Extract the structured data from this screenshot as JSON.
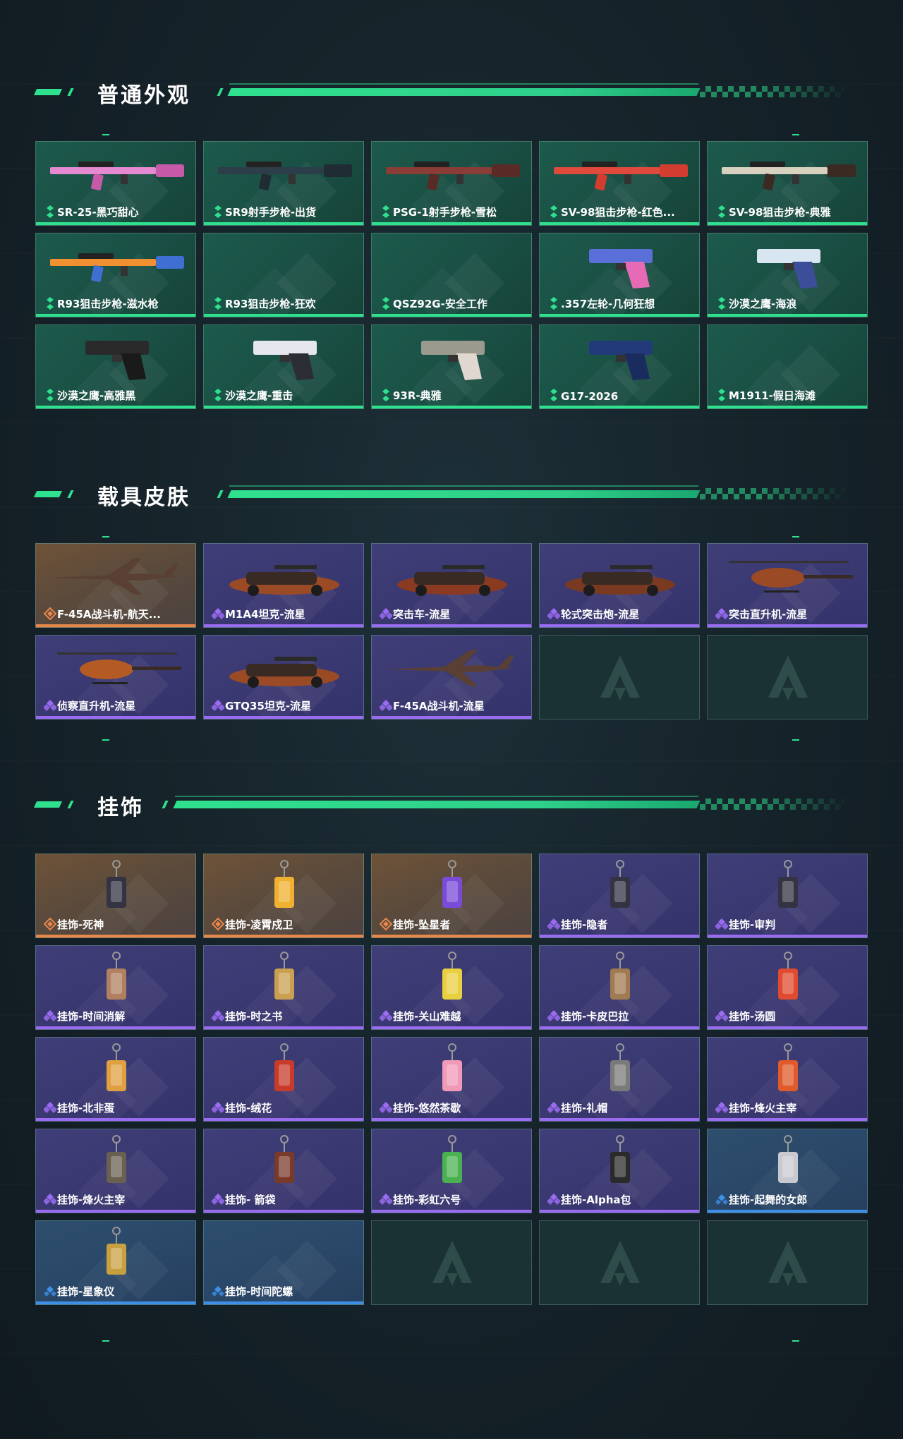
{
  "sections": {
    "skins": {
      "title": "普通外观",
      "items": [
        {
          "label": "SR-25-黑巧甜心",
          "rarity": "green",
          "icon": "rifle-pink-icon"
        },
        {
          "label": "SR9射手步枪-出货",
          "rarity": "green",
          "icon": "rifle-dark-icon"
        },
        {
          "label": "PSG-1射手步枪-雪松",
          "rarity": "green",
          "icon": "sniper-red-icon"
        },
        {
          "label": "SV-98狙击步枪-红色...",
          "rarity": "green",
          "icon": "sniper-orange-icon"
        },
        {
          "label": "SV-98狙击步枪-典雅",
          "rarity": "green",
          "icon": "sniper-white-icon"
        },
        {
          "label": "R93狙击步枪-滋水枪",
          "rarity": "green",
          "icon": "sniper-toy-icon"
        },
        {
          "label": "R93狙击步枪-狂欢",
          "rarity": "green",
          "icon": ""
        },
        {
          "label": "QSZ92G-安全工作",
          "rarity": "green",
          "icon": ""
        },
        {
          "label": ".357左轮-几何狂想",
          "rarity": "green",
          "icon": "revolver-icon"
        },
        {
          "label": "沙漠之鹰-海浪",
          "rarity": "green",
          "icon": "pistol-wave-icon"
        },
        {
          "label": "沙漠之鹰-高雅黑",
          "rarity": "green",
          "icon": "pistol-black-icon"
        },
        {
          "label": "沙漠之鹰-重击",
          "rarity": "green",
          "icon": "pistol-white-icon"
        },
        {
          "label": "93R-典雅",
          "rarity": "green",
          "icon": "pistol-silver-icon"
        },
        {
          "label": "G17-2026",
          "rarity": "green",
          "icon": "pistol-navy-icon"
        },
        {
          "label": "M1911-假日海滩",
          "rarity": "green",
          "icon": ""
        }
      ]
    },
    "vehicles": {
      "title": "载具皮肤",
      "items": [
        {
          "label": "F-45A战斗机-航天...",
          "rarity": "orange",
          "icon": "jet-icon"
        },
        {
          "label": "M1A4坦克-流星",
          "rarity": "purple",
          "icon": "tank-icon"
        },
        {
          "label": "突击车-流星",
          "rarity": "purple",
          "icon": "assault-vehicle-icon"
        },
        {
          "label": "轮式突击炮-流星",
          "rarity": "purple",
          "icon": "wheeled-gun-icon"
        },
        {
          "label": "突击直升机-流星",
          "rarity": "purple",
          "icon": "attack-helicopter-icon"
        },
        {
          "label": "侦察直升机-流星",
          "rarity": "purple",
          "icon": "scout-helicopter-icon"
        },
        {
          "label": "GTQ35坦克-流星",
          "rarity": "purple",
          "icon": "tank-icon"
        },
        {
          "label": "F-45A战斗机-流星",
          "rarity": "purple",
          "icon": "jet-icon"
        },
        {
          "label": "",
          "rarity": "empty",
          "icon": "placeholder-logo-icon"
        },
        {
          "label": "",
          "rarity": "empty",
          "icon": "placeholder-logo-icon"
        }
      ]
    },
    "charms": {
      "title": "挂饰",
      "items": [
        {
          "label": "挂饰-死神",
          "rarity": "orange",
          "icon": "charm-card-icon"
        },
        {
          "label": "挂饰-凌霄戍卫",
          "rarity": "orange",
          "icon": "charm-figure-icon"
        },
        {
          "label": "挂饰-坠星者",
          "rarity": "orange",
          "icon": "charm-crystal-icon"
        },
        {
          "label": "挂饰-隐者",
          "rarity": "purple",
          "icon": "charm-card-icon"
        },
        {
          "label": "挂饰-审判",
          "rarity": "purple",
          "icon": "charm-card-icon"
        },
        {
          "label": "挂饰-时间消解",
          "rarity": "purple",
          "icon": "charm-small-icon"
        },
        {
          "label": "挂饰-时之书",
          "rarity": "purple",
          "icon": "charm-book-icon"
        },
        {
          "label": "挂饰-关山难越",
          "rarity": "purple",
          "icon": "charm-tube-icon"
        },
        {
          "label": "挂饰-卡皮巴拉",
          "rarity": "purple",
          "icon": "charm-capybara-icon"
        },
        {
          "label": "挂饰-汤圆",
          "rarity": "purple",
          "icon": "charm-bowl-icon"
        },
        {
          "label": "挂饰-北非蛋",
          "rarity": "purple",
          "icon": "charm-egg-icon"
        },
        {
          "label": "挂饰-绒花",
          "rarity": "purple",
          "icon": "charm-flower-icon"
        },
        {
          "label": "挂饰-悠然茶歇",
          "rarity": "purple",
          "icon": "charm-cupcake-icon"
        },
        {
          "label": "挂饰-礼帽",
          "rarity": "purple",
          "icon": "charm-hat-icon"
        },
        {
          "label": "挂饰-烽火主宰",
          "rarity": "purple",
          "icon": "charm-banner-icon"
        },
        {
          "label": "挂饰-烽火主宰",
          "rarity": "purple",
          "icon": "charm-pyramid-icon"
        },
        {
          "label": "挂饰- 箭袋",
          "rarity": "purple",
          "icon": "charm-quiver-icon"
        },
        {
          "label": "挂饰-彩虹六号",
          "rarity": "purple",
          "icon": "charm-six-icon"
        },
        {
          "label": "挂饰-Alpha包",
          "rarity": "purple",
          "icon": "charm-bag-icon"
        },
        {
          "label": "挂饰-起舞的女郎",
          "rarity": "blue",
          "icon": "charm-dancer-icon"
        },
        {
          "label": "挂饰-星象仪",
          "rarity": "blue",
          "icon": "charm-astrolabe-icon"
        },
        {
          "label": "挂饰-时间陀螺",
          "rarity": "blue",
          "icon": ""
        },
        {
          "label": "",
          "rarity": "empty",
          "icon": "placeholder-logo-icon"
        },
        {
          "label": "",
          "rarity": "empty",
          "icon": "placeholder-logo-icon"
        },
        {
          "label": "",
          "rarity": "empty",
          "icon": "placeholder-logo-icon"
        }
      ]
    }
  },
  "colors": {
    "accent": "#2fe08e",
    "green": "#2fe08e",
    "purple": "#9a6cf2",
    "orange": "#e8874a",
    "blue": "#3d8fe8"
  }
}
